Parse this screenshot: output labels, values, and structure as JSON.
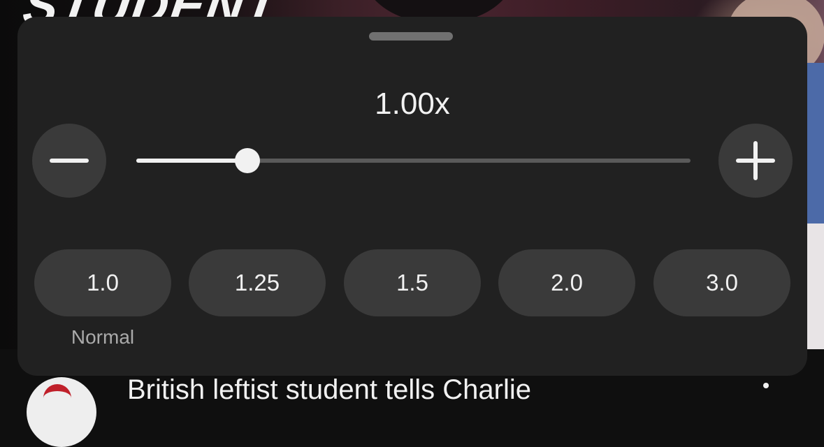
{
  "background": {
    "video_overlay_word": "STUDENT"
  },
  "speed_sheet": {
    "current_speed": "1.00x",
    "slider": {
      "value": 1.0,
      "min": 0.25,
      "max": 4.0
    },
    "decrease_icon": "minus-icon",
    "increase_icon": "plus-icon",
    "presets": [
      {
        "label": "1.0",
        "note": "Normal"
      },
      {
        "label": "1.25"
      },
      {
        "label": "1.5"
      },
      {
        "label": "2.0"
      },
      {
        "label": "3.0"
      }
    ]
  },
  "video_info": {
    "title": "British leftist student tells Charlie",
    "more_icon": "more-vert-icon"
  },
  "colors": {
    "sheet_background": "#212121",
    "button_background": "#3a3a3a",
    "text_primary": "#f1f1f1",
    "text_secondary": "#aaaaaa"
  }
}
